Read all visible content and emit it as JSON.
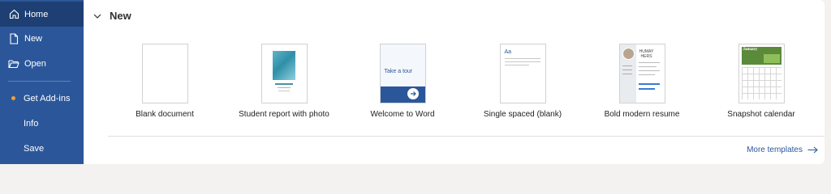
{
  "sidebar": {
    "items": [
      {
        "label": "Home",
        "icon": "home-icon"
      },
      {
        "label": "New",
        "icon": "new-document-icon"
      },
      {
        "label": "Open",
        "icon": "open-folder-icon"
      },
      {
        "label": "Get Add-ins",
        "icon": "notification-dot"
      },
      {
        "label": "Info"
      },
      {
        "label": "Save"
      }
    ],
    "active": "Home"
  },
  "section": {
    "title": "New"
  },
  "templates": [
    {
      "label": "Blank document"
    },
    {
      "label": "Student report with photo"
    },
    {
      "label": "Welcome to Word",
      "thumb_text": "Take a tour"
    },
    {
      "label": "Single spaced (blank)",
      "thumb_text": "Aa"
    },
    {
      "label": "Bold modern resume",
      "thumb_text": "HUMAY HERS"
    },
    {
      "label": "Snapshot calendar",
      "thumb_text": "January"
    }
  ],
  "more_templates": {
    "label": "More templates"
  },
  "colors": {
    "sidebar": "#2b579a",
    "active": "#1e3f73",
    "accent": "#2b579a",
    "dot": "#f29d38"
  }
}
